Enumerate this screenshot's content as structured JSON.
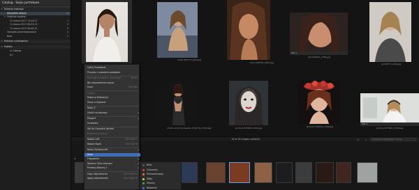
{
  "app": {
    "catalog_title": "Catalog - Sesje portretowe"
  },
  "sidebar": {
    "items": [
      {
        "label": "Kolekcje katalogu",
        "type": "header",
        "count": ""
      },
      {
        "label": "Wszystkie obrazy",
        "type": "selected",
        "count": "18"
      },
      {
        "label": "Ostatnie importy",
        "type": "group",
        "count": ""
      },
      {
        "label": "11 marca 2017 13:24:17",
        "type": "sub",
        "count": "4"
      },
      {
        "label": "11 marca 2017 09:53:13",
        "type": "sub",
        "count": "6"
      },
      {
        "label": "11 marca 2017 09:45:11",
        "type": "sub",
        "count": "8"
      },
      {
        "label": "Obrazów przechowywania",
        "type": "item",
        "count": "0"
      },
      {
        "label": "Kosz",
        "type": "item",
        "count": "0"
      },
      {
        "label": "Kolekcje użytkownika",
        "type": "header",
        "count": ""
      },
      {
        "label": "Foldery",
        "type": "header",
        "count": ""
      },
      {
        "label": "In Catalog",
        "type": "sub",
        "count": ""
      },
      {
        "label": "D:\\",
        "type": "sub",
        "count": ""
      }
    ]
  },
  "grid": {
    "items": [
      {
        "file": "",
        "rating": ""
      },
      {
        "file": "woda PH5771_000.jpg",
        "rating": ""
      },
      {
        "file": "face-124930_1000.jpg",
        "rating": ""
      },
      {
        "file": "girl-529331_1000.jpg",
        "rating": "ISO 1"
      },
      {
        "file": "girl-6073_1000.jpg",
        "rating": ""
      },
      {
        "file": "",
        "rating": ""
      },
      {
        "file": "photo-shoot-to-beauty-1742744_1000.jpg",
        "rating": ""
      },
      {
        "file": "portrait-615926_1000.jpg",
        "rating": ""
      },
      {
        "file": "woman-752234_1000.jpg",
        "rating": ""
      },
      {
        "file": "woman-877660_1000.jpg",
        "rating": "ISO 1"
      }
    ]
  },
  "context_menu": {
    "items": [
      {
        "label": "Cofnij Przesłanie",
        "state": "",
        "shortcut": "",
        "sub": false
      },
      {
        "label": "Przypisz z poziomie podglądu",
        "state": "",
        "shortcut": "",
        "sub": false
      },
      {
        "label": "Przenieś do folderu roboczego",
        "state": "dis",
        "shortcut": "Ctrl+F",
        "sub": false
      },
      {
        "label": "Nie odpowiednie edycje",
        "state": "",
        "shortcut": "",
        "sub": false
      },
      {
        "label": "Usuń",
        "state": "",
        "shortcut": "Ctrl+Del",
        "sub": false
      },
      {
        "label": "Locate",
        "state": "dis",
        "shortcut": "",
        "sub": false
      },
      {
        "label": "Pokaż w Referencji",
        "state": "",
        "shortcut": "",
        "sub": false
      },
      {
        "label": "Show in Explorer",
        "state": "",
        "shortcut": "",
        "sub": false
      },
      {
        "label": "Rotuj Z",
        "state": "",
        "shortcut": "",
        "sub": false
      },
      {
        "label": "Obróć na pionowy",
        "state": "",
        "shortcut": "",
        "sub": true
      },
      {
        "label": "Eksport",
        "state": "",
        "shortcut": "",
        "sub": true
      },
      {
        "label": "Przetwórz",
        "state": "",
        "shortcut": "",
        "sub": false
      },
      {
        "label": "Set As Compare Variant",
        "state": "",
        "shortcut": "",
        "sub": false
      },
      {
        "label": "Porównaj w Edycji",
        "state": "dis",
        "shortcut": "",
        "sub": false
      },
      {
        "label": "Rotate Left",
        "state": "",
        "shortcut": "Ctrl+Alt+L",
        "sub": false
      },
      {
        "label": "Rotate Right",
        "state": "",
        "shortcut": "Ctrl+Alt+R",
        "sub": false
      },
      {
        "label": "Nowy Zastosuj dla",
        "state": "",
        "shortcut": "",
        "sub": true
      },
      {
        "label": "Kolor",
        "state": "hl",
        "shortcut": "",
        "sub": true
      },
      {
        "label": "Flagowane",
        "state": "",
        "shortcut": "",
        "sub": true
      },
      {
        "label": "Wybierz Tylko Zaznacz",
        "state": "",
        "shortcut": "",
        "sub": true
      },
      {
        "label": "Przesłuj Albumy 2",
        "state": "",
        "shortcut": "",
        "sub": true
      },
      {
        "label": "Copy Adjustments",
        "state": "",
        "shortcut": "Ctrl+Shift+C",
        "sub": false
      },
      {
        "label": "Apply Adjustments",
        "state": "",
        "shortcut": "Ctrl+Shift+V",
        "sub": false
      }
    ]
  },
  "color_submenu": {
    "items": [
      {
        "label": "Brak",
        "color": "#555555"
      },
      {
        "label": "Czerwony",
        "color": "#d23b3b"
      },
      {
        "label": "Pomarańczowy",
        "color": "#e07a2a"
      },
      {
        "label": "Żółty",
        "color": "#d9c53a"
      },
      {
        "label": "Zielony",
        "color": "#47a447"
      },
      {
        "label": "Niebieski",
        "color": "#3a73d2"
      }
    ]
  },
  "status": {
    "selection_text": "10 of 18 images selected",
    "search_placeholder": "Przeszukaj Wszystkie obrazy"
  },
  "colors": {
    "accent": "#3f6cb6",
    "panel": "#1e1e1e"
  }
}
